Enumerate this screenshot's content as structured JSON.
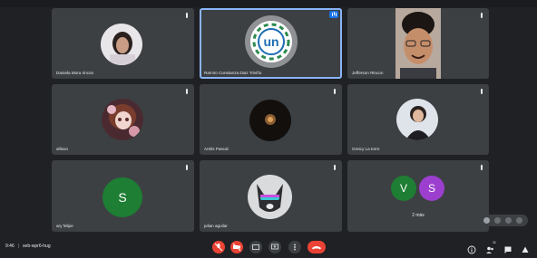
{
  "tiles": [
    {
      "name": "Daniela Mora rincon"
    },
    {
      "name": "Ramiro Constanza Diaz Triviño"
    },
    {
      "name": "Jefferson Rincon"
    },
    {
      "name": "allison"
    },
    {
      "name": "Arelis Pascal"
    },
    {
      "name": "Greicy La torre"
    },
    {
      "name": "ary felipe",
      "initial": "S",
      "color": "#1e7e34"
    },
    {
      "name": "julian aguilar"
    },
    {
      "name": "2 más",
      "initials": [
        "V",
        "S"
      ],
      "colors": [
        "#1e7e34",
        "#9c3fce"
      ]
    }
  ],
  "meeting": {
    "time": "9:46",
    "separator": "|",
    "code": "seb-wpr6-hug"
  },
  "icons": {
    "mic": "mic-off-icon",
    "camera": "camera-off-icon",
    "captions": "captions-icon",
    "present": "present-screen-icon",
    "more": "more-options-icon",
    "hangup": "hang-up-icon",
    "info": "info-icon",
    "people": "people-icon",
    "chat": "chat-icon",
    "activities": "activities-icon"
  },
  "badges": {
    "people_count": "11"
  },
  "colors": {
    "background": "#202124",
    "tile": "#3c4043",
    "danger": "#ea4335",
    "active_border": "#8ab4f8"
  }
}
